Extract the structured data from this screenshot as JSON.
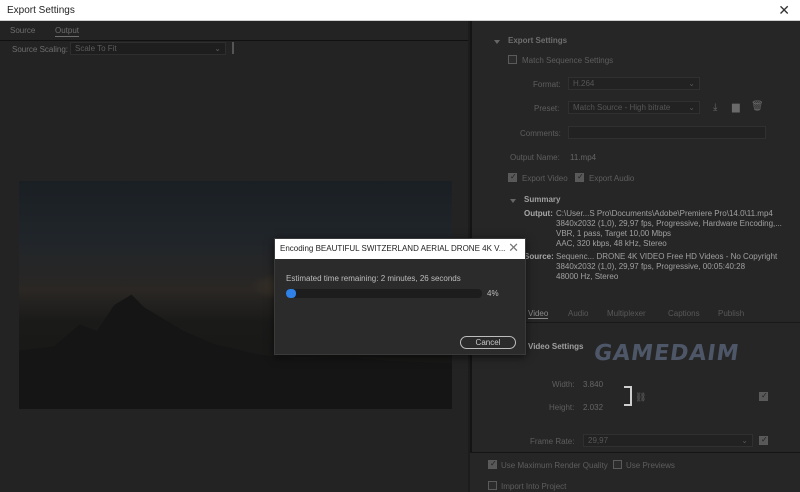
{
  "window": {
    "title": "Export Settings",
    "close_glyph": "✕"
  },
  "left_panel": {
    "tabs": [
      "Source",
      "Output"
    ],
    "source_scaling_label": "Source Scaling:",
    "source_scaling_value": "Scale To Fit"
  },
  "export_settings": {
    "section_title": "Export Settings",
    "match_sequence_label": "Match Sequence Settings",
    "format_label": "Format:",
    "format_value": "H.264",
    "preset_label": "Preset:",
    "preset_value": "Match Source - High bitrate",
    "comments_label": "Comments:",
    "comments_value": "",
    "output_name_label": "Output Name:",
    "output_name_value": "11.mp4",
    "export_video_label": "Export Video",
    "export_audio_label": "Export Audio"
  },
  "summary": {
    "title": "Summary",
    "output_key": "Output:",
    "output_lines": [
      "C:\\User...S Pro\\Documents\\Adobe\\Premiere Pro\\14.0\\11.mp4",
      "3840x2032 (1,0), 29,97 fps, Progressive, Hardware Encoding,...",
      "VBR, 1 pass, Target 10,00 Mbps",
      "AAC, 320 kbps, 48 kHz, Stereo"
    ],
    "source_key": "Source:",
    "source_lines": [
      "Sequenc... DRONE 4K VIDEO   Free HD Videos - No Copyright",
      "3840x2032 (1,0), 29,97 fps, Progressive, 00:05:40:28",
      "48000 Hz, Stereo"
    ]
  },
  "tabs_lower": [
    "Video",
    "Audio",
    "Multiplexer",
    "Captions",
    "Publish"
  ],
  "video_settings": {
    "title": "Video Settings",
    "width_label": "Width:",
    "width_value": "3.840",
    "height_label": "Height:",
    "height_value": "2.032",
    "frame_rate_label": "Frame Rate:",
    "frame_rate_value": "29,97"
  },
  "bottom": {
    "max_render_label": "Use Maximum Render Quality",
    "use_previews_label": "Use Previews",
    "import_label": "Import Into Project"
  },
  "watermark": "GAMEDAIM",
  "dialog": {
    "title": "Encoding BEAUTIFUL SWITZERLAND   AERIAL DRONE 4K V...",
    "close_glyph": "✕",
    "estimate": "Estimated time remaining: 2 minutes, 26 seconds",
    "progress_percent": 4,
    "progress_label": "4%",
    "cancel_label": "Cancel",
    "accent_color": "#2f80e7"
  }
}
